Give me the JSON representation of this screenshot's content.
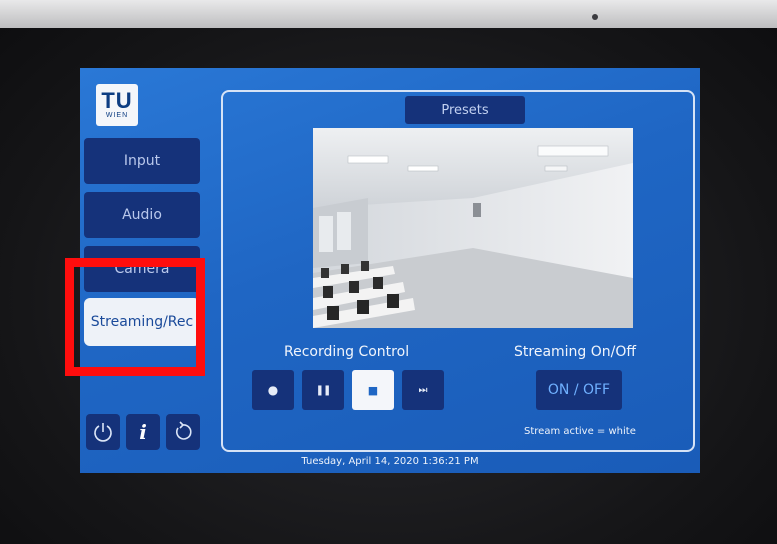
{
  "logo": {
    "line1": "TU",
    "line2": "WIEN"
  },
  "nav": {
    "items": [
      {
        "label": "Input"
      },
      {
        "label": "Audio"
      },
      {
        "label": "Camera"
      },
      {
        "label": "Streaming/Rec"
      }
    ],
    "active_index": 3
  },
  "presets": {
    "label": "Presets"
  },
  "recording": {
    "title": "Recording Control",
    "buttons": [
      {
        "name": "record",
        "glyph": "●"
      },
      {
        "name": "pause",
        "glyph": "❚❚"
      },
      {
        "name": "stop",
        "glyph": "■"
      },
      {
        "name": "skip",
        "glyph": "⏭"
      }
    ]
  },
  "streaming": {
    "title": "Streaming On/Off",
    "toggle_label": "ON / OFF",
    "note": "Stream active = white"
  },
  "footer": {
    "datetime": "Tuesday, April 14, 2020 1:36:21 PM"
  },
  "colors": {
    "screen_bg": "#1f66c4",
    "button_bg": "#15327a",
    "highlight": "#ff0d0d"
  },
  "icons": [
    "power-icon",
    "info-icon",
    "reset-icon"
  ]
}
